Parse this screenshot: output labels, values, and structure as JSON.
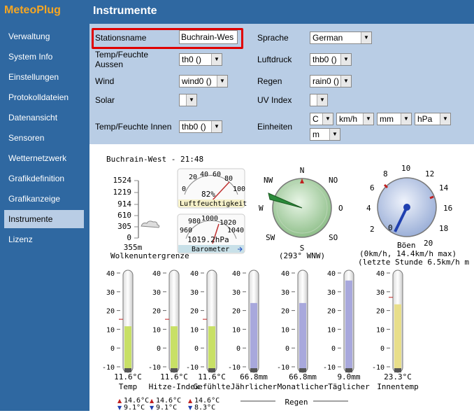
{
  "app": {
    "brand": "MeteoPlug",
    "page_title": "Instrumente"
  },
  "sidebar": {
    "items": [
      {
        "label": "Verwaltung",
        "active": false
      },
      {
        "label": "System Info",
        "active": false
      },
      {
        "label": "Einstellungen",
        "active": false
      },
      {
        "label": "Protokolldateien",
        "active": false
      },
      {
        "label": "Datenansicht",
        "active": false
      },
      {
        "label": "Sensoren",
        "active": false
      },
      {
        "label": "Wetternetzwerk",
        "active": false
      },
      {
        "label": "Grafikdefinition",
        "active": false
      },
      {
        "label": "Grafikanzeige",
        "active": false
      },
      {
        "label": "Instrumente",
        "active": true
      },
      {
        "label": "Lizenz",
        "active": false
      }
    ]
  },
  "form": {
    "stationsname_label": "Stationsname",
    "stationsname_value": "Buchrain-Wes",
    "temp_feuchte_aussen_label_1": "Temp/Feuchte",
    "temp_feuchte_aussen_label_2": "Aussen",
    "temp_feuchte_aussen_value": "th0 ()",
    "wind_label": "Wind",
    "wind_value": "wind0 ()",
    "solar_label": "Solar",
    "solar_value": "",
    "temp_feuchte_innen_label": "Temp/Feuchte Innen",
    "temp_feuchte_innen_value": "thb0 ()",
    "sprache_label": "Sprache",
    "sprache_value": "German",
    "luftdruck_label": "Luftdruck",
    "luftdruck_value": "thb0 ()",
    "regen_label": "Regen",
    "regen_value": "rain0 ()",
    "uv_label": "UV Index",
    "uv_value": "",
    "einheiten_label": "Einheiten",
    "einheit_temp": "C",
    "einheit_wind": "km/h",
    "einheit_regen": "mm",
    "einheit_druck": "hPa",
    "einheit_hoehe": "m"
  },
  "instruments": {
    "header": "Buchrain-West - 21:48",
    "cloud": {
      "ticks": [
        "1524",
        "1219",
        "914",
        "610",
        "305",
        "0"
      ],
      "value": "355m",
      "label": "Wolkenuntergrenze"
    },
    "humidity": {
      "ticks": [
        "0",
        "20",
        "40",
        "60",
        "80",
        "100"
      ],
      "value_text": "82%",
      "value": 82,
      "label": "Luftfeuchtigkeit"
    },
    "barometer": {
      "ticks": [
        "960",
        "980",
        "1000",
        "1020",
        "1040"
      ],
      "value_text": "1019.2hPa",
      "value": 1019.2,
      "label": "Barometer"
    },
    "compass": {
      "dirs": [
        "N",
        "NO",
        "O",
        "SO",
        "S",
        "SW",
        "W",
        "NW"
      ],
      "value_text": "(293° WNW)",
      "direction": 293
    },
    "gust": {
      "ticks": [
        "0",
        "2",
        "4",
        "6",
        "8",
        "10",
        "12",
        "14",
        "16",
        "18",
        "20"
      ],
      "label": "Böen",
      "line1": "(0km/h, 14.4km/h max)",
      "line2": "(letzte Stunde 6.5km/h m",
      "value": 0,
      "max": 14.4,
      "hour_max": 6.5
    },
    "thermo_scale": [
      "40",
      "30",
      "20",
      "10",
      "0",
      "-10"
    ],
    "thermometers": [
      {
        "value_text": "11.6°C",
        "label": "Temp",
        "value": 11.6,
        "color": "#c8e066"
      },
      {
        "value_text": "11.6°C",
        "label": "Hitze-Index",
        "value": 11.6,
        "color": "#c8e066"
      },
      {
        "value_text": "11.6°C",
        "label": "Gefühlte",
        "value": 11.6,
        "color": "#c8e066"
      },
      {
        "value_text": "66.8mm",
        "label": "Jährlicher",
        "fill": 0.68,
        "color": "#a8a8dc"
      },
      {
        "value_text": "66.8mm",
        "label": "Monatlicher",
        "fill": 0.68,
        "color": "#a8a8dc"
      },
      {
        "value_text": "9.0mm",
        "label": "Täglicher",
        "fill": 0.92,
        "color": "#a8a8dc"
      },
      {
        "value_text": "23.3°C",
        "label": "Innentemp",
        "value": 23.3,
        "color": "#e8de8a"
      }
    ],
    "minmax": [
      {
        "max": "14.6°C",
        "min": "9.1°C"
      },
      {
        "max": "14.6°C",
        "min": "9.1°C"
      },
      {
        "max": "14.6°C",
        "min": "8.3°C"
      }
    ],
    "regen_label": "Regen"
  }
}
